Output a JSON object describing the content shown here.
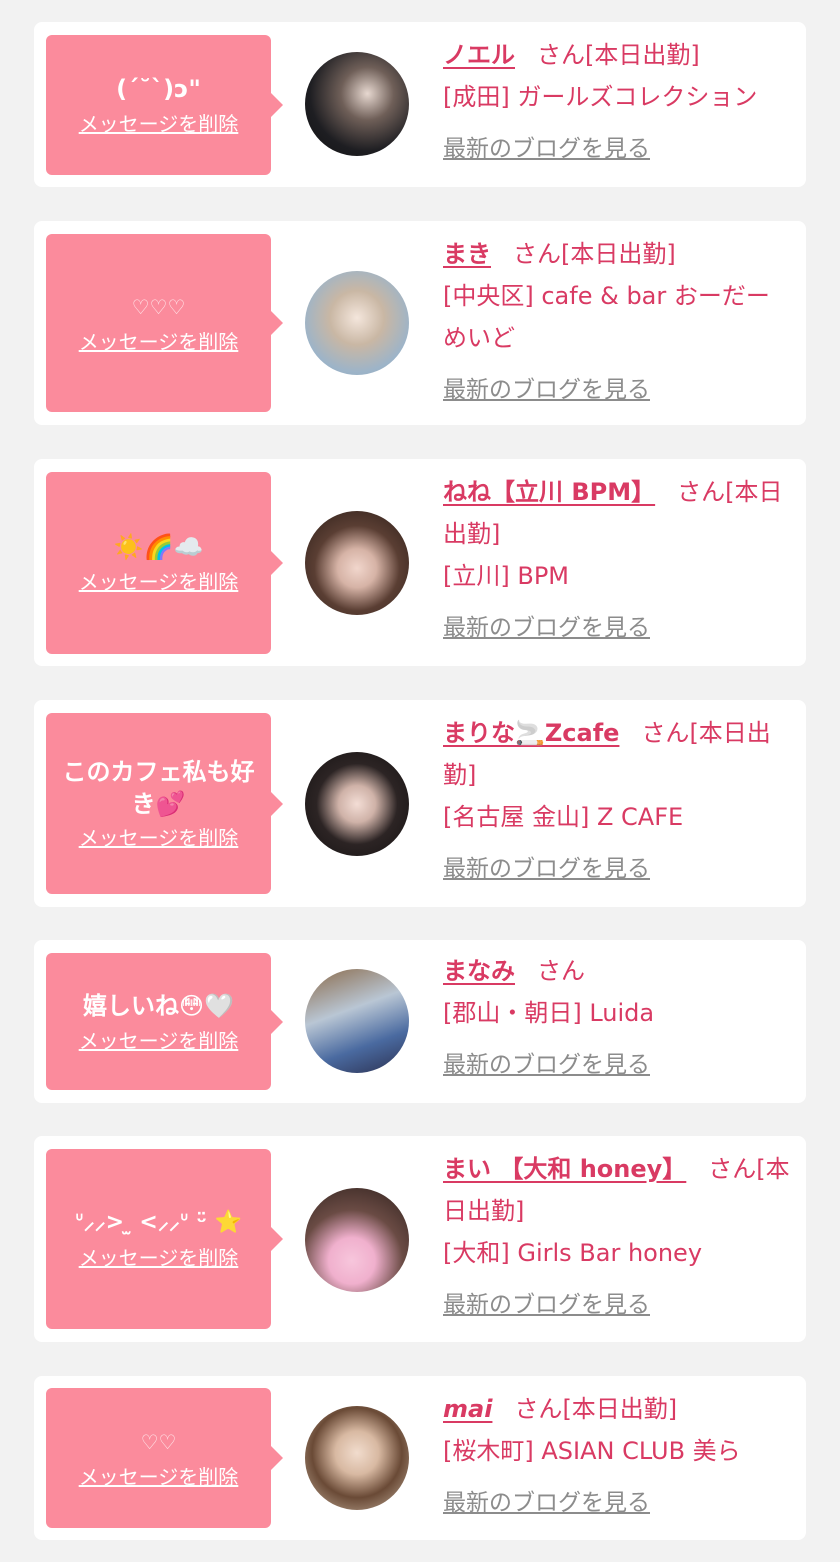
{
  "common": {
    "delete_label": "メッセージを削除",
    "blog_label": "最新のブログを見る",
    "san": "さん"
  },
  "items": [
    {
      "message": "(ˊ˘ˋ)ɔ\"",
      "name": "ノエル",
      "status": "[本日出勤]",
      "shop": "[成田] ガールズコレクション"
    },
    {
      "message": "♡♡♡",
      "name": "まき",
      "status": "[本日出勤]",
      "shop": "[中央区] cafe & bar おーだーめいど"
    },
    {
      "message": "☀️🌈☁️",
      "name": "ねね【立川 BPM】",
      "status": "[本日出勤]",
      "shop": "[立川] BPM"
    },
    {
      "message": "このカフェ私も好き💕",
      "name": "まりな🚬Zcafe",
      "status": "[本日出勤]",
      "shop": "[名古屋 金山] Z CAFE"
    },
    {
      "message": "嬉しいね😳🤍",
      "name": "まなみ",
      "status": "",
      "shop": "[郡山・朝日] Luida"
    },
    {
      "message": "ᐡ⸝⸝> ̫ <⸝⸝ᐡ ᵕ̈ ⭐️",
      "name": "まい 【大和 honey】",
      "status": "[本日出勤]",
      "shop": "[大和] Girls Bar honey"
    },
    {
      "message": "♡♡",
      "name": "mai",
      "status": "[本日出勤]",
      "shop": "[桜木町] ASIAN CLUB 美ら"
    }
  ],
  "colors": {
    "accent": "#d93a63",
    "bubble": "#fb8b9c",
    "link_gray": "#8c8c8c",
    "background": "#f2f2f2"
  }
}
